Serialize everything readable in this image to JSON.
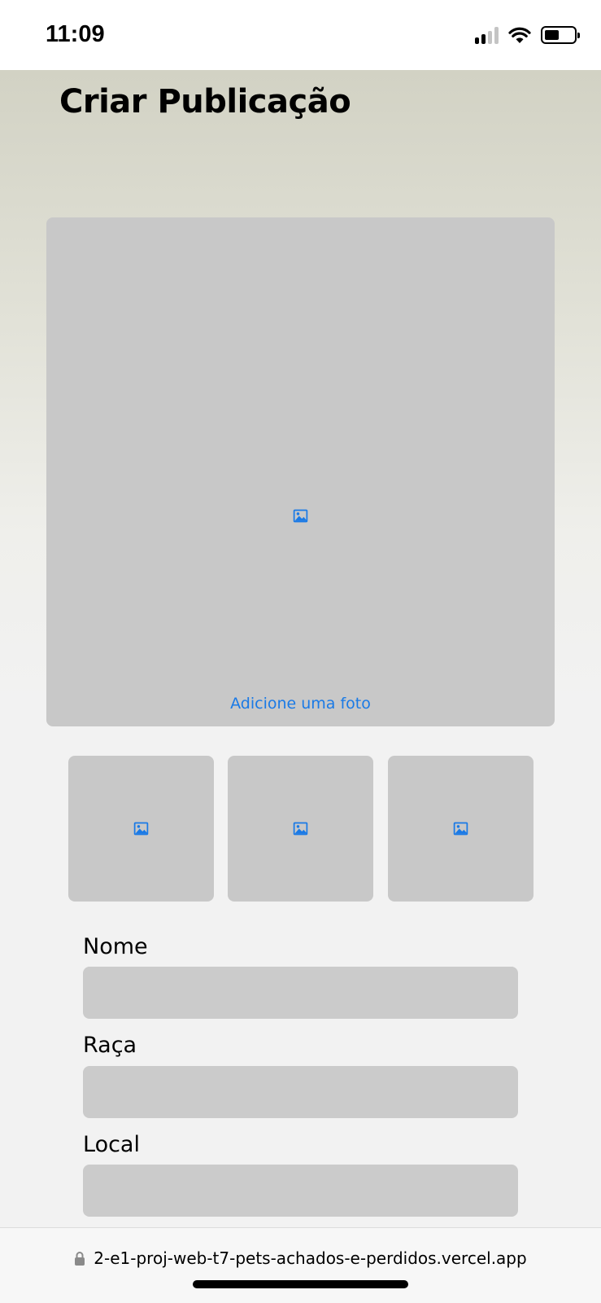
{
  "status_bar": {
    "time": "11:09",
    "icons": [
      "cellular-signal-icon",
      "wifi-icon",
      "battery-icon"
    ],
    "battery_level": 0.5
  },
  "page": {
    "title": "Criar Publicação"
  },
  "photos": {
    "main_label": "Adicione uma foto",
    "icon": "image-icon",
    "icon_color": "#1a7ae6",
    "thumbnail_count": 3
  },
  "form": {
    "fields": [
      {
        "label": "Nome",
        "value": ""
      },
      {
        "label": "Raça",
        "value": ""
      },
      {
        "label": "Local",
        "value": ""
      }
    ]
  },
  "browser": {
    "url": "2-e1-proj-web-t7-pets-achados-e-perdidos.vercel.app",
    "lock_icon": "lock-icon"
  }
}
